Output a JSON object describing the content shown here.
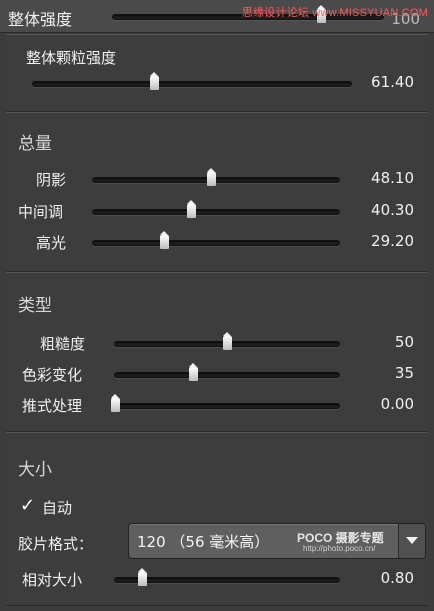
{
  "top": {
    "label": "整体强度",
    "value": "100",
    "fill": 0.77,
    "watermark": "思缘设计论坛 www.MISSYUAN.COM"
  },
  "grain": {
    "label": "整体颗粒强度",
    "value": "61.40",
    "fill": 0.38
  },
  "amount": {
    "title": "总量",
    "items": [
      {
        "label": "阴影",
        "value": "48.10",
        "fill": 0.48
      },
      {
        "label": "中间调",
        "value": "40.30",
        "fill": 0.4
      },
      {
        "label": "高光",
        "value": "29.20",
        "fill": 0.29
      }
    ]
  },
  "type": {
    "title": "类型",
    "items": [
      {
        "label": "粗糙度",
        "value": "50",
        "fill": 0.5
      },
      {
        "label": "色彩变化",
        "value": "35",
        "fill": 0.35
      },
      {
        "label": "推式处理",
        "value": "0.00",
        "fill": 0.0
      }
    ]
  },
  "size": {
    "title": "大小",
    "auto_label": "自动",
    "auto_checked": true,
    "film_label": "胶片格式：",
    "film_value": "120 （56 毫米高）",
    "poco_logo": "POCO 摄影专题",
    "poco_url": "http://photo.poco.cn/",
    "relative_label": "相对大小",
    "relative_value": "0.80",
    "relative_fill": 0.12
  }
}
